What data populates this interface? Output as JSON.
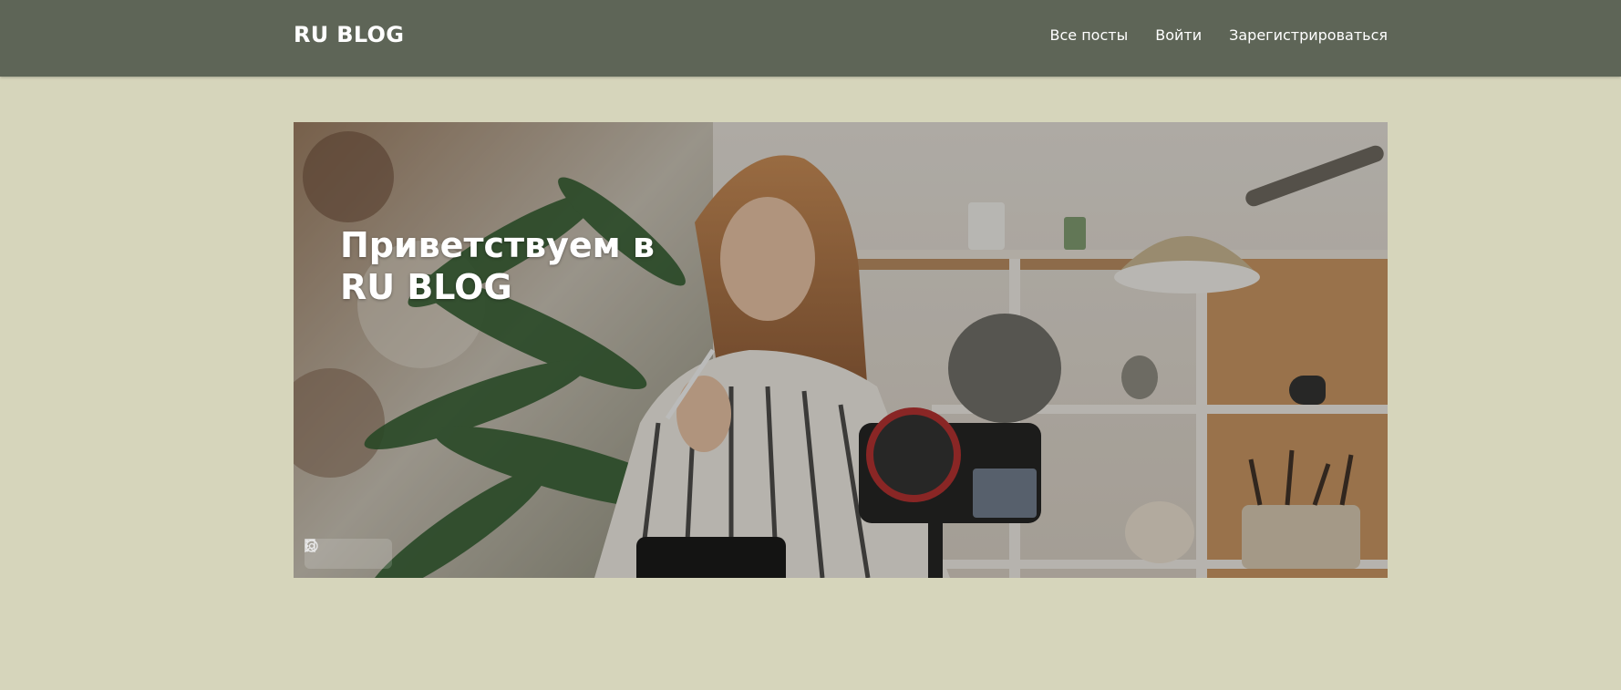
{
  "navbar": {
    "brand": "RU BLOG",
    "links": [
      {
        "label": "Все посты"
      },
      {
        "label": "Войти"
      },
      {
        "label": "Зарегистрироваться"
      }
    ]
  },
  "hero": {
    "title": "Приветствуем в RU BLOG",
    "toolbar_icons": [
      "bookmark-icon",
      "lens-icon",
      "more-dots-icon"
    ]
  },
  "colors": {
    "navbar_bg": "#5e6557",
    "page_bg": "#d6d5bb",
    "text": "#ffffff"
  }
}
